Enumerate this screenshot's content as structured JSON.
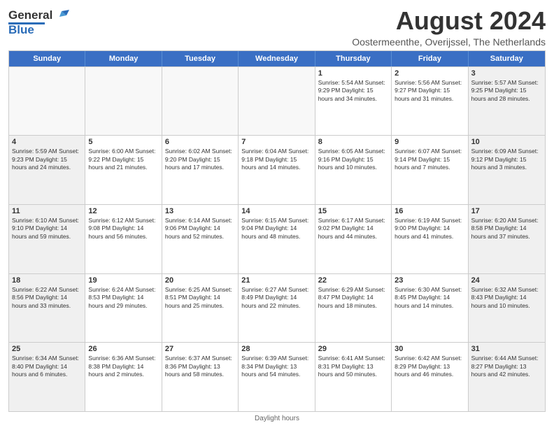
{
  "header": {
    "logo": {
      "line1": "General",
      "line2": "Blue"
    },
    "title": "August 2024",
    "subtitle": "Oostermeenthe, Overijssel, The Netherlands"
  },
  "days_of_week": [
    "Sunday",
    "Monday",
    "Tuesday",
    "Wednesday",
    "Thursday",
    "Friday",
    "Saturday"
  ],
  "footer": {
    "text": "Daylight hours"
  },
  "weeks": [
    [
      {
        "day": "",
        "content": ""
      },
      {
        "day": "",
        "content": ""
      },
      {
        "day": "",
        "content": ""
      },
      {
        "day": "",
        "content": ""
      },
      {
        "day": "1",
        "content": "Sunrise: 5:54 AM\nSunset: 9:29 PM\nDaylight: 15 hours\nand 34 minutes."
      },
      {
        "day": "2",
        "content": "Sunrise: 5:56 AM\nSunset: 9:27 PM\nDaylight: 15 hours\nand 31 minutes."
      },
      {
        "day": "3",
        "content": "Sunrise: 5:57 AM\nSunset: 9:25 PM\nDaylight: 15 hours\nand 28 minutes."
      }
    ],
    [
      {
        "day": "4",
        "content": "Sunrise: 5:59 AM\nSunset: 9:23 PM\nDaylight: 15 hours\nand 24 minutes."
      },
      {
        "day": "5",
        "content": "Sunrise: 6:00 AM\nSunset: 9:22 PM\nDaylight: 15 hours\nand 21 minutes."
      },
      {
        "day": "6",
        "content": "Sunrise: 6:02 AM\nSunset: 9:20 PM\nDaylight: 15 hours\nand 17 minutes."
      },
      {
        "day": "7",
        "content": "Sunrise: 6:04 AM\nSunset: 9:18 PM\nDaylight: 15 hours\nand 14 minutes."
      },
      {
        "day": "8",
        "content": "Sunrise: 6:05 AM\nSunset: 9:16 PM\nDaylight: 15 hours\nand 10 minutes."
      },
      {
        "day": "9",
        "content": "Sunrise: 6:07 AM\nSunset: 9:14 PM\nDaylight: 15 hours\nand 7 minutes."
      },
      {
        "day": "10",
        "content": "Sunrise: 6:09 AM\nSunset: 9:12 PM\nDaylight: 15 hours\nand 3 minutes."
      }
    ],
    [
      {
        "day": "11",
        "content": "Sunrise: 6:10 AM\nSunset: 9:10 PM\nDaylight: 14 hours\nand 59 minutes."
      },
      {
        "day": "12",
        "content": "Sunrise: 6:12 AM\nSunset: 9:08 PM\nDaylight: 14 hours\nand 56 minutes."
      },
      {
        "day": "13",
        "content": "Sunrise: 6:14 AM\nSunset: 9:06 PM\nDaylight: 14 hours\nand 52 minutes."
      },
      {
        "day": "14",
        "content": "Sunrise: 6:15 AM\nSunset: 9:04 PM\nDaylight: 14 hours\nand 48 minutes."
      },
      {
        "day": "15",
        "content": "Sunrise: 6:17 AM\nSunset: 9:02 PM\nDaylight: 14 hours\nand 44 minutes."
      },
      {
        "day": "16",
        "content": "Sunrise: 6:19 AM\nSunset: 9:00 PM\nDaylight: 14 hours\nand 41 minutes."
      },
      {
        "day": "17",
        "content": "Sunrise: 6:20 AM\nSunset: 8:58 PM\nDaylight: 14 hours\nand 37 minutes."
      }
    ],
    [
      {
        "day": "18",
        "content": "Sunrise: 6:22 AM\nSunset: 8:56 PM\nDaylight: 14 hours\nand 33 minutes."
      },
      {
        "day": "19",
        "content": "Sunrise: 6:24 AM\nSunset: 8:53 PM\nDaylight: 14 hours\nand 29 minutes."
      },
      {
        "day": "20",
        "content": "Sunrise: 6:25 AM\nSunset: 8:51 PM\nDaylight: 14 hours\nand 25 minutes."
      },
      {
        "day": "21",
        "content": "Sunrise: 6:27 AM\nSunset: 8:49 PM\nDaylight: 14 hours\nand 22 minutes."
      },
      {
        "day": "22",
        "content": "Sunrise: 6:29 AM\nSunset: 8:47 PM\nDaylight: 14 hours\nand 18 minutes."
      },
      {
        "day": "23",
        "content": "Sunrise: 6:30 AM\nSunset: 8:45 PM\nDaylight: 14 hours\nand 14 minutes."
      },
      {
        "day": "24",
        "content": "Sunrise: 6:32 AM\nSunset: 8:43 PM\nDaylight: 14 hours\nand 10 minutes."
      }
    ],
    [
      {
        "day": "25",
        "content": "Sunrise: 6:34 AM\nSunset: 8:40 PM\nDaylight: 14 hours\nand 6 minutes."
      },
      {
        "day": "26",
        "content": "Sunrise: 6:36 AM\nSunset: 8:38 PM\nDaylight: 14 hours\nand 2 minutes."
      },
      {
        "day": "27",
        "content": "Sunrise: 6:37 AM\nSunset: 8:36 PM\nDaylight: 13 hours\nand 58 minutes."
      },
      {
        "day": "28",
        "content": "Sunrise: 6:39 AM\nSunset: 8:34 PM\nDaylight: 13 hours\nand 54 minutes."
      },
      {
        "day": "29",
        "content": "Sunrise: 6:41 AM\nSunset: 8:31 PM\nDaylight: 13 hours\nand 50 minutes."
      },
      {
        "day": "30",
        "content": "Sunrise: 6:42 AM\nSunset: 8:29 PM\nDaylight: 13 hours\nand 46 minutes."
      },
      {
        "day": "31",
        "content": "Sunrise: 6:44 AM\nSunset: 8:27 PM\nDaylight: 13 hours\nand 42 minutes."
      }
    ]
  ]
}
